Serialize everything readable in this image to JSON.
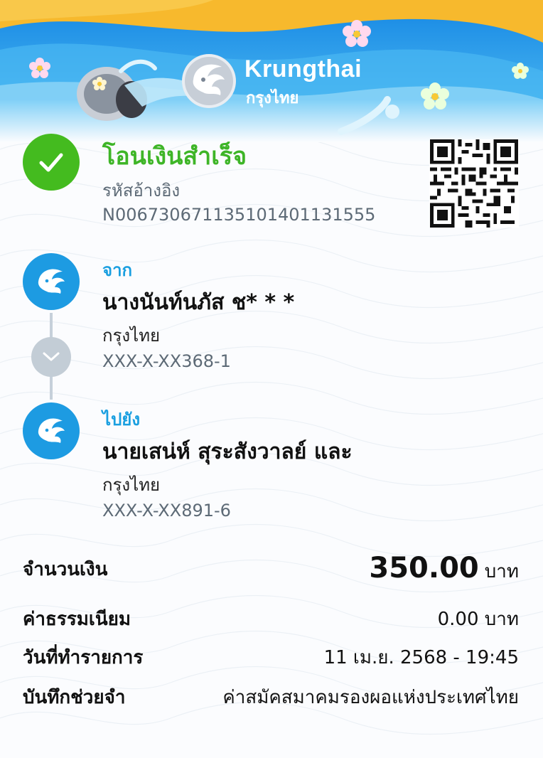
{
  "brand": {
    "name_en": "Krungthai",
    "name_th": "กรุงไทย"
  },
  "status": {
    "title": "โอนเงินสำเร็จ",
    "ref_label": "รหัสอ้างอิง",
    "ref_number": "N006730671135101401131555"
  },
  "from": {
    "role_label": "จาก",
    "name": "นางนันท์นภัส ช* * *",
    "bank": "กรุงไทย",
    "account": "XXX-X-XX368-1"
  },
  "to": {
    "role_label": "ไปยัง",
    "name": "นายเสน่ห์ สุระสังวาลย์ และ",
    "bank": "กรุงไทย",
    "account": "XXX-X-XX891-6"
  },
  "details": {
    "amount_label": "จำนวนเงิน",
    "amount_value": "350.00",
    "amount_unit": "บาท",
    "fee_label": "ค่าธรรมเนียม",
    "fee_value": "0.00 บาท",
    "date_label": "วันที่ทำรายการ",
    "date_value": "11 เม.ย. 2568 - 19:45",
    "memo_label": "บันทึกช่วยจำ",
    "memo_value": "ค่าสมัคสมาคมรองผอแห่งประเทศไทย"
  },
  "icons": {
    "status": "check-icon",
    "avatar": "krungthai-bird-logo-icon",
    "connector": "chevron-down-icon"
  },
  "colors": {
    "success_green": "#44bb1f",
    "krungthai_blue": "#1d9be2",
    "header_yellow": "#f7b92d",
    "header_blue": "#2aa5ea"
  }
}
